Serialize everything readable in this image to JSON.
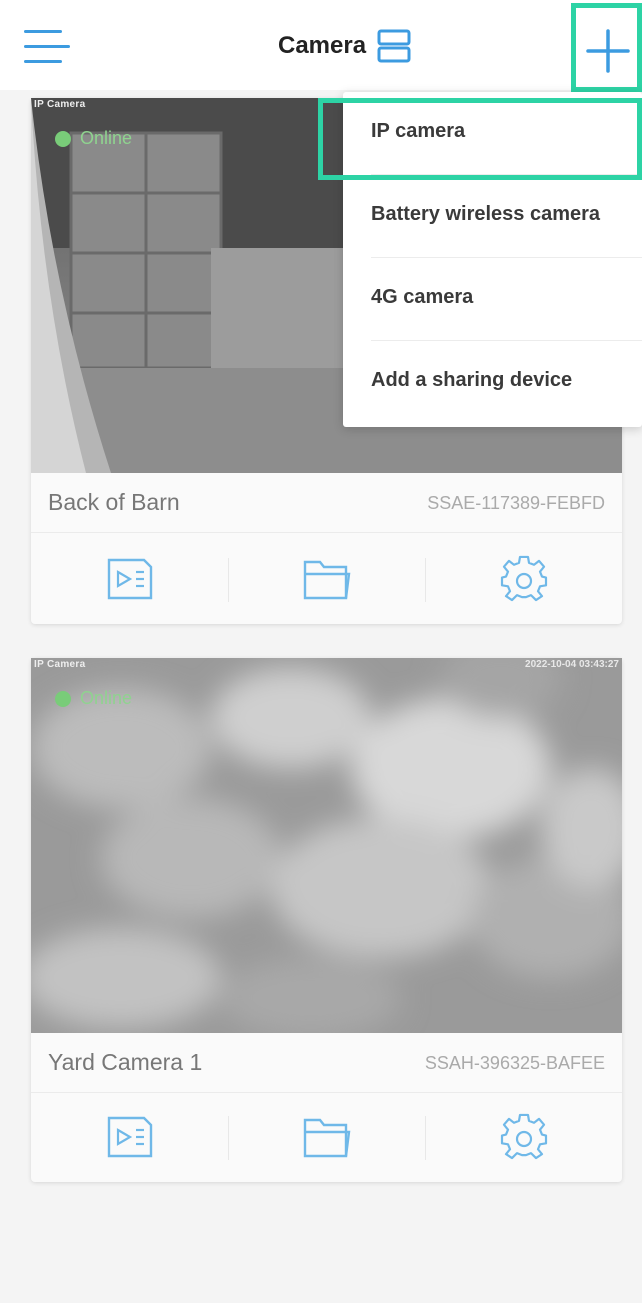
{
  "header": {
    "title": "Camera",
    "menu_icon": "hamburger-menu-icon",
    "layout_icon": "list-layout-icon",
    "add_icon": "plus-icon",
    "accent_color": "#3c9be0"
  },
  "dropdown": {
    "items": [
      {
        "label": "IP camera"
      },
      {
        "label": "Battery wireless camera"
      },
      {
        "label": "4G camera"
      },
      {
        "label": "Add a sharing device"
      }
    ]
  },
  "highlight_color": "#2dd3a5",
  "cameras": [
    {
      "overlay_label": "IP Camera",
      "status": "Online",
      "name": "Back of Barn",
      "device_id": "SSAE-117389-FEBFD"
    },
    {
      "overlay_label": "IP Camera",
      "timestamp": "2022-10-04 03:43:27",
      "status": "Online",
      "name": "Yard Camera 1",
      "device_id": "SSAH-396325-BAFEE"
    }
  ],
  "card_actions": [
    "playback-icon",
    "folder-icon",
    "gear-icon"
  ]
}
